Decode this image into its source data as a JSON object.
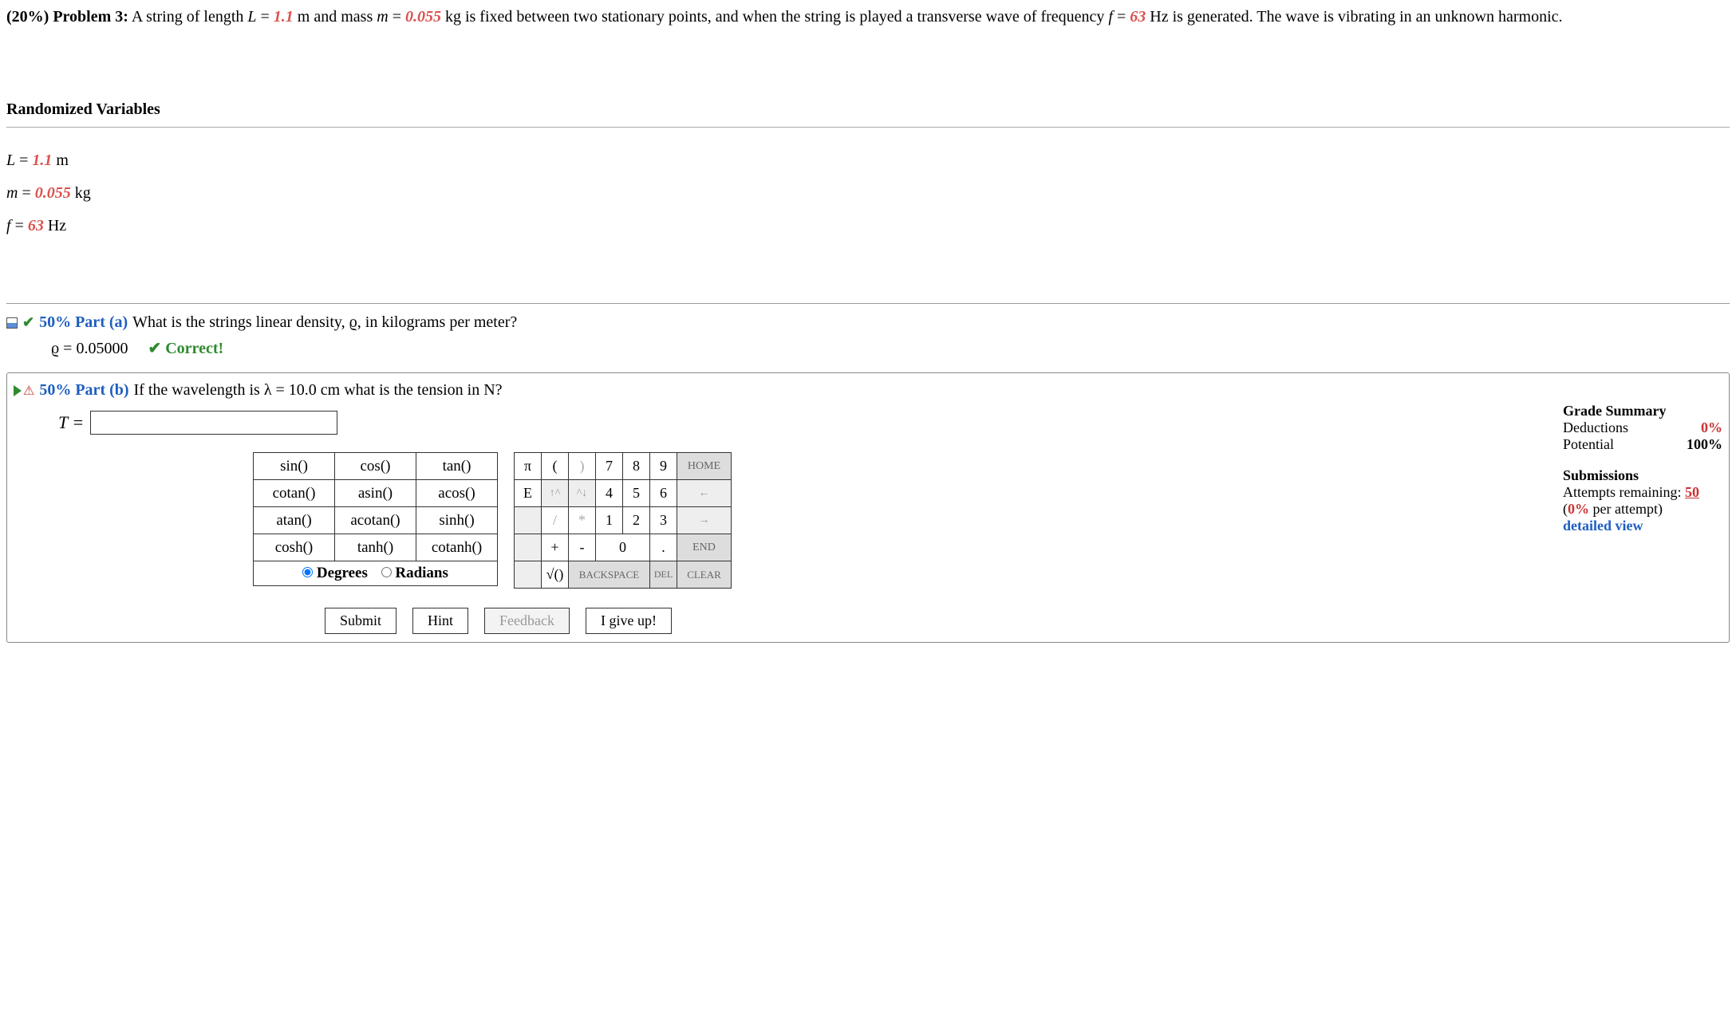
{
  "problem": {
    "weight_label": "(20%) Problem 3:",
    "text_1": "A string of length ",
    "L_var": "L",
    "L_eq": " = ",
    "L_val": "1.1",
    "L_unit": " m and mass ",
    "m_var": "m",
    "m_eq": " = ",
    "m_val": "0.055",
    "m_unit": " kg is fixed between two stationary points, and when the string is played a transverse wave of frequency ",
    "f_var": "f",
    "f_eq": " = ",
    "f_val": "63",
    "f_unit": " Hz is generated. The wave is vibrating in an unknown harmonic."
  },
  "rv": {
    "heading": "Randomized Variables",
    "L": {
      "sym": "L",
      "eq": " = ",
      "val": "1.1",
      "unit": " m"
    },
    "m": {
      "sym": "m",
      "eq": " = ",
      "val": "0.055",
      "unit": " kg"
    },
    "f": {
      "sym": "f",
      "eq": " = ",
      "val": "63",
      "unit": " Hz"
    }
  },
  "partA": {
    "pct": "50% Part (a)",
    "question": "What is the strings linear density, ϱ, in kilograms per meter?",
    "answer_lhs": "ϱ = 0.05000",
    "correct": "✔ Correct!"
  },
  "partB": {
    "pct": "50% Part (b)",
    "question": "If the wavelength is λ = 10.0 cm what is the tension in N?",
    "lhs": "T = ",
    "input_value": ""
  },
  "grade": {
    "heading": "Grade Summary",
    "deductions_label": "Deductions",
    "deductions_val": "0%",
    "potential_label": "Potential",
    "potential_val": "100%",
    "sub_heading": "Submissions",
    "attempts_label": "Attempts remaining: ",
    "attempts_val": "50",
    "penalty": "(0% per attempt)",
    "detailed": "detailed view"
  },
  "funcs": {
    "r1c1": "sin()",
    "r1c2": "cos()",
    "r1c3": "tan()",
    "r2c1": "cotan()",
    "r2c2": "asin()",
    "r2c3": "acos()",
    "r3c1": "atan()",
    "r3c2": "acotan()",
    "r3c3": "sinh()",
    "r4c1": "cosh()",
    "r4c2": "tanh()",
    "r4c3": "cotanh()",
    "deg": "Degrees",
    "rad": "Radians"
  },
  "keys": {
    "pi": "π",
    "lpar": "(",
    "rpar": ")",
    "n7": "7",
    "n8": "8",
    "n9": "9",
    "home": "HOME",
    "E": "E",
    "up": "↑^",
    "dn": "^↓",
    "n4": "4",
    "n5": "5",
    "n6": "6",
    "left": "←",
    "slash": "/",
    "star": "*",
    "n1": "1",
    "n2": "2",
    "n3": "3",
    "right": "→",
    "plus": "+",
    "minus": "-",
    "n0": "0",
    "dot": ".",
    "end": "END",
    "sqrt": "√()",
    "bksp": "BACKSPACE",
    "del": "DEL",
    "clear": "CLEAR"
  },
  "buttons": {
    "submit": "Submit",
    "hint": "Hint",
    "feedback": "Feedback",
    "giveup": "I give up!"
  }
}
